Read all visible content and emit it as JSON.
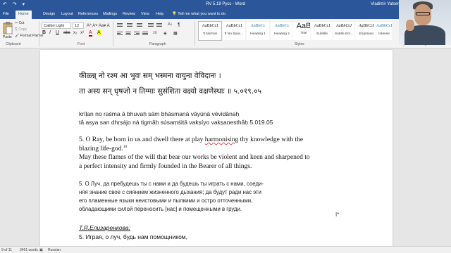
{
  "titlebar": {
    "doc_title": "RV 5.19 Pycc  -  Word",
    "user": "Vladimir Yatsenko",
    "quick_access": "↶ ↷ ▾"
  },
  "tabs": [
    "File",
    "Home",
    "Design",
    "Layout",
    "References",
    "Mailings",
    "Review",
    "View",
    "Help"
  ],
  "tell_me": "Tell me what you want to do",
  "ribbon": {
    "clipboard": {
      "paste": "Paste",
      "cut": "Cut",
      "copy": "Copy",
      "format_painter": "Format Painter",
      "label": "Clipboard"
    },
    "font": {
      "name": "Calibri Light",
      "size": "12",
      "label": "Font",
      "buttons": [
        "B",
        "I",
        "U",
        "abc",
        "x₂",
        "x²",
        "A",
        "A"
      ]
    },
    "paragraph": {
      "label": "Paragraph"
    },
    "styles": {
      "label": "Styles",
      "items": [
        {
          "preview": "AaBbCcI",
          "name": "¶ Normal"
        },
        {
          "preview": "AaBbCcI",
          "name": "¶ No Spac..."
        },
        {
          "preview": "AaBbCc",
          "name": "Heading 1"
        },
        {
          "preview": "AaBbCc",
          "name": "Heading 2"
        },
        {
          "preview": "AaB",
          "name": "Title"
        },
        {
          "preview": "AaBbCcI",
          "name": "Subtitle"
        },
        {
          "preview": "AaBbCcI",
          "name": "Subtle Em..."
        },
        {
          "preview": "AaBbCcI",
          "name": "Emphasis"
        },
        {
          "preview": "AaBbCcI",
          "name": "Intense"
        }
      ]
    },
    "editing": {
      "label": "Editing"
    }
  },
  "document": {
    "sanskrit_1": "कीळ्न्न् नो रश्म आ भुवः सम् भस्मना वायुना वेविदानः ।",
    "sanskrit_2": "ता अस्य सन् धृषजो न तिग्माः सुसंशिता वक्ष्यो वक्षणेस्थाः ॥ ५.०१९.०५",
    "translit_1": "krīḷan no raśma ā bhuvaḥ sám bhásmanā vāyúnā vévidānaḥ",
    "translit_2": "tā́ asya san dhṛṣájo ná tigmā́ḥ súsaṃśitā vakṣíyo vakṣaṇesthā́ḥ  5.019.05",
    "eng_1a": "5. O Ray, be born in us and dwell there at play ",
    "eng_1b": "harmonising",
    "eng_1c": " thy knowledge with the",
    "eng_2": "blazing life-god.",
    "eng_2_sup": "10",
    "eng_3": "May these flames of the will that bear our works be violent and keen and sharpened to",
    "eng_4": "a perfect intensity and firmly founded in the Bearer of all things.",
    "rus_1": "5. О Луч, да пребудешь ты с нами и да будешь ты играть с нами, соеди-",
    "rus_2": "няя знание свое с сиянием жизненного дыхания; да будут ради нас эти",
    "rus_3": "его пламенные языки неистовыми и пылкими и остро отточенными,",
    "rus_4": "обладающими силой переносить [нас] и помещенными в груди.",
    "author": "Т.Я.Елизаренкова:",
    "rus_5": "5. Играя, о луч, будь нам помощником,"
  },
  "statusbar": {
    "page": "9 of 11",
    "words": "3461 words",
    "language": "Russian"
  }
}
